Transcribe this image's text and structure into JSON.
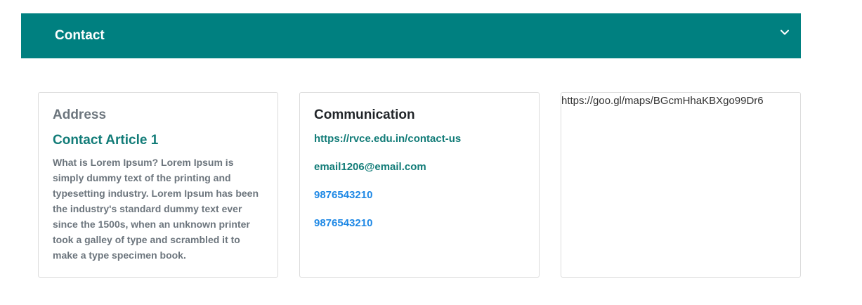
{
  "accordion": {
    "title": "Contact",
    "toggle_icon": "chevron-down-icon",
    "background_color": "#008080"
  },
  "address_card": {
    "heading": "Address",
    "article_title": "Contact Article 1",
    "article_body": "What is Lorem Ipsum? Lorem Ipsum is simply dummy text of the printing and typesetting industry. Lorem Ipsum has been the industry's standard dummy text ever since the 1500s, when an unknown printer took a galley of type and scrambled it to make a type specimen book."
  },
  "communication_card": {
    "heading": "Communication",
    "website": "https://rvce.edu.in/contact-us",
    "email": "email1206@email.com",
    "phone_1": "9876543210",
    "phone_2": "9876543210"
  },
  "map_card": {
    "url_text": "https://goo.gl/maps/BGcmHhaKBXgo99Dr6"
  },
  "colors": {
    "accent_teal": "#127c78",
    "link_blue": "#1e88e5",
    "muted_gray": "#6c757d"
  }
}
